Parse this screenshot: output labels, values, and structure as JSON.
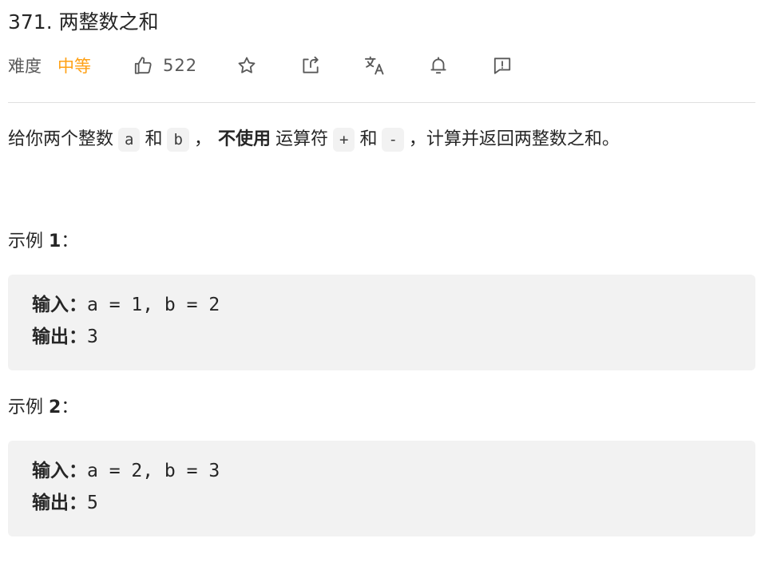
{
  "problem": {
    "title": "371. 两整数之和",
    "difficulty_label": "难度",
    "difficulty": "中等",
    "likes": "522"
  },
  "toolbar": {
    "icons": [
      "thumbs-up-icon",
      "star-icon",
      "share-icon",
      "translate-icon",
      "bell-icon",
      "feedback-icon"
    ]
  },
  "description": {
    "part1": "给你两个整数",
    "code_a": "a",
    "part2": "和",
    "code_b": "b",
    "part3": "，",
    "bold": "不使用",
    "part4": "运算符",
    "code_plus": "+",
    "part5": "和",
    "code_minus": "-",
    "part6": "，计算并返回两整数之和。"
  },
  "examples": [
    {
      "title_prefix": "示例 ",
      "title_num": "1",
      "title_suffix": "：",
      "input_label": "输入：",
      "input_value": "a = 1, b = 2",
      "output_label": "输出：",
      "output_value": "3"
    },
    {
      "title_prefix": "示例 ",
      "title_num": "2",
      "title_suffix": "：",
      "input_label": "输入：",
      "input_value": "a = 2, b = 3",
      "output_label": "输出：",
      "output_value": "5"
    }
  ],
  "colors": {
    "difficulty_medium": "#ffa116",
    "text": "#262626",
    "muted": "#595959",
    "code_bg": "#f2f2f2"
  }
}
